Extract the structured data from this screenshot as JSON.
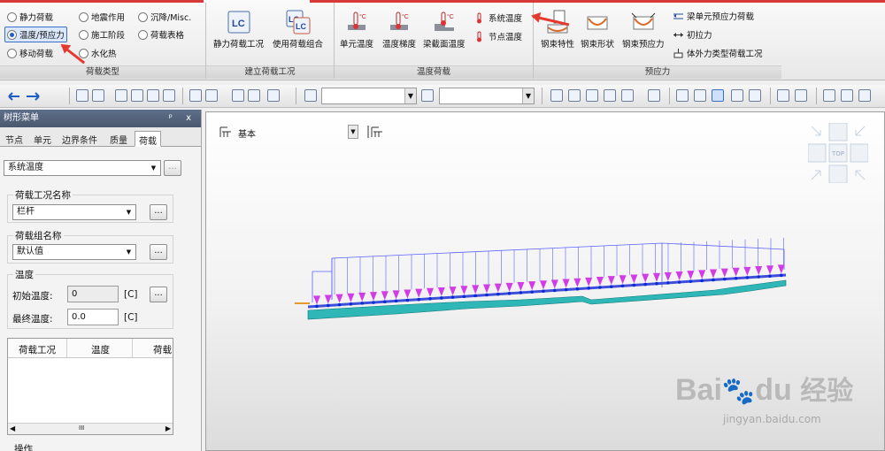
{
  "ribbon": {
    "load_type_group": {
      "title": "荷载类型",
      "options": [
        {
          "label": "静力荷载",
          "selected": false
        },
        {
          "label": "地震作用",
          "selected": false
        },
        {
          "label": "沉降/Misc.",
          "selected": false
        },
        {
          "label": "温度/预应力",
          "selected": true
        },
        {
          "label": "施工阶段",
          "selected": false
        },
        {
          "label": "荷载表格",
          "selected": false
        },
        {
          "label": "移动荷载",
          "selected": false
        },
        {
          "label": "水化热",
          "selected": false
        }
      ]
    },
    "load_case_group": {
      "title": "建立荷载工况",
      "buttons": [
        "静力荷载工况",
        "使用荷载组合"
      ]
    },
    "temperature_group": {
      "title": "温度荷载",
      "buttons": [
        "单元温度",
        "温度梯度",
        "梁截面温度"
      ],
      "small_buttons": [
        "系统温度",
        "节点温度"
      ]
    },
    "prestress_group": {
      "title": "预应力",
      "buttons": [
        "钢束特性",
        "钢束形状",
        "钢束预应力"
      ],
      "small_buttons": [
        "梁单元预应力荷载",
        "初拉力",
        "体外力类型荷载工况"
      ]
    }
  },
  "left_panel": {
    "title": "树形菜单",
    "title_controls": "ᵖ x",
    "tabs": [
      "节点",
      "单元",
      "边界条件",
      "质量",
      "荷载"
    ],
    "active_tab": "荷载",
    "top_combo": "系统温度",
    "top_combo_button": "...",
    "load_case": {
      "legend": "荷载工况名称",
      "value": "栏杆",
      "button": "..."
    },
    "load_group": {
      "legend": "荷载组名称",
      "value": "默认值",
      "button": "..."
    },
    "temperature": {
      "legend": "温度",
      "initial_label": "初始温度:",
      "initial_value": "0",
      "initial_unit": "[C]",
      "initial_button": "...",
      "final_label": "最终温度:",
      "final_value": "0.0",
      "final_unit": "[C]"
    },
    "table_headers": [
      "荷载工况",
      "温度",
      "荷载"
    ],
    "scroll_label": "III",
    "footer_label": "操作"
  },
  "viewport": {
    "combo_value": "基本",
    "nav_cube_label": "TOP",
    "model_colors": {
      "load_arrows": "#d23ce6",
      "bridge": "#2fb7b7",
      "frame": "#5a63ff",
      "nodes": "#0b2bd8"
    }
  },
  "watermark": {
    "brand": "Bai",
    "brand2": "du",
    "cn": "经验",
    "url": "jingyan.baidu.com"
  }
}
